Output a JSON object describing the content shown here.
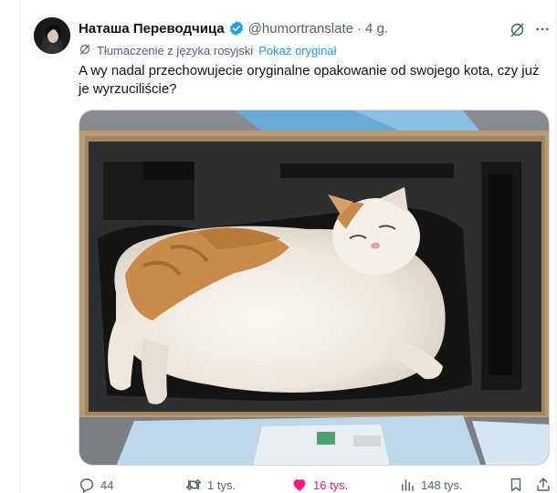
{
  "tweet": {
    "display_name": "Наташа Переводчица",
    "handle": "@humortranslate",
    "separator": "·",
    "time": "4 g.",
    "translation_note": "Tłumaczenie z języka rosyjski",
    "show_original": "Pokaż oryginał",
    "text": "A wy nadal przechowujecie oryginalne opakowanie od swojego kota, czy już je wyrzuciliście?",
    "image_alt": "Cat sleeping in a foam-lined case"
  },
  "actions": {
    "replies": "44",
    "reposts": "1 tys.",
    "likes": "16 tys.",
    "views": "148 tys."
  },
  "colors": {
    "text": "#0f1419",
    "secondary": "#536471",
    "link": "#1d9bf0",
    "like": "#f91880",
    "verified": "#1d9bf0"
  },
  "icons": [
    "verified-badge-icon",
    "grok-icon",
    "more-icon",
    "translate-icon",
    "reply-icon",
    "repost-icon",
    "like-icon",
    "views-icon",
    "bookmark-icon",
    "share-icon"
  ]
}
